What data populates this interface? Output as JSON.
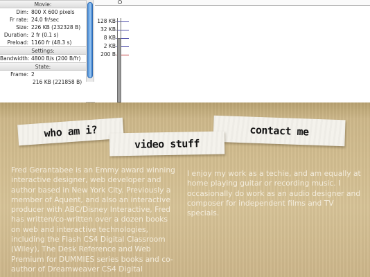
{
  "profiler": {
    "sections": {
      "movie": "Movie:",
      "settings": "Settings:",
      "state": "State:"
    },
    "movie_rows": [
      {
        "label": "Dim:",
        "value": "800 X 600 pixels"
      },
      {
        "label": "Fr rate:",
        "value": "24.0 fr/sec"
      },
      {
        "label": "Size:",
        "value": "226 KB (232328 B)"
      },
      {
        "label": "Duration:",
        "value": "2 fr (0.1 s)"
      },
      {
        "label": "Preload:",
        "value": "1160 fr (48.3 s)"
      }
    ],
    "settings_rows": [
      {
        "label": "Bandwidth:",
        "value": "4800 B/s (200 B/fr)"
      }
    ],
    "state_rows": [
      {
        "label": "Frame:",
        "value": "2"
      }
    ],
    "state_extra": "216 KB (221858 B)",
    "graph_labels": [
      "128 KB",
      "32 KB",
      "8 KB",
      "2 KB",
      "200 B"
    ]
  },
  "site": {
    "nav": {
      "about": "who am i?",
      "video": "video stuff",
      "contact": "contact me"
    },
    "bio_left": "Fred Gerantabee is an Emmy award winning interactive designer, web developer and author based in New York City. Previously a member of Aquent, and also an interactive producer with ABC/Disney Interactive, Fred has written/co-written over a dozen books on web and interactive technologies, including the Flash CS4 Digital Classroom (Wiley), The Desk Reference and Web Premium for DUMMIES series books and co-author of Dreamweaver CS4 Digital",
    "bio_right": "I enjoy my work as a techie, and am equally at home playing guitar or recording music. I occasionally do work as an audio designer and composer for independent films and TV specials."
  }
}
